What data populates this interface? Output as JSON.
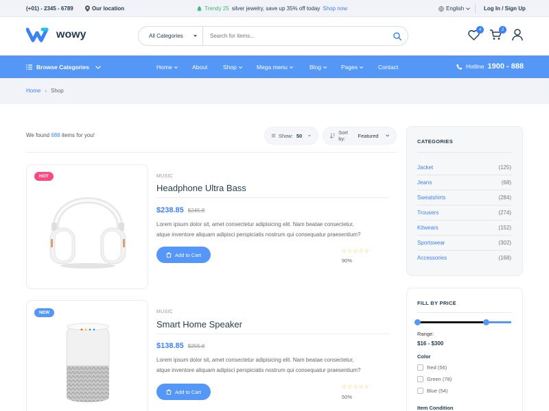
{
  "topbar": {
    "phone": "(+01) - 2345 - 6789",
    "location": "Our location",
    "promo_highlight": "Trendy 25",
    "promo_text": "silver jewelry, save up 35% off today",
    "promo_link": "Shop now",
    "language": "English",
    "login": "Log In / Sign Up"
  },
  "header": {
    "logo": "wowy",
    "search_category": "All Categories",
    "search_placeholder": "Search for items...",
    "wishlist_count": "4",
    "cart_count": "2"
  },
  "nav": {
    "browse": "Browse Categories",
    "items": [
      "Home",
      "About",
      "Shop",
      "Mega menu",
      "Blog",
      "Pages",
      "Contact"
    ],
    "hotline_label": "Hotline",
    "hotline_number": "1900 - 888"
  },
  "breadcrumb": {
    "home": "Home",
    "current": "Shop"
  },
  "toolbar": {
    "found_prefix": "We found",
    "found_count": "688",
    "found_suffix": "items for you!",
    "show_label": "Show:",
    "show_value": "50",
    "sort_label": "Sort by:",
    "sort_value": "Featured"
  },
  "products": [
    {
      "tag": "HOT",
      "category": "MUSIC",
      "title": "Headphone Ultra Bass",
      "price": "$238.85",
      "old_price": "$245.8",
      "desc_1": "Lorem ipsum dolor sit, amet consectetur adipisicing elit. Nam beatae consectetur,",
      "desc_2": "atque inventore aliquam adipisci perspiciatis nostrum qui consequatur praesentium?",
      "cart_label": "Add to Cart",
      "stars": "☆☆☆☆☆",
      "rating": "90%"
    },
    {
      "tag": "NEW",
      "category": "MUSIC",
      "title": "Smart Home Speaker",
      "price": "$138.85",
      "old_price": "$255.8",
      "desc_1": "Lorem ipsum dolor sit, amet consectetur adipisicing elit. Nam beatae consectetur,",
      "desc_2": "atque inventore aliquam adipisci perspiciatis nostrum qui consequatur praesentium?",
      "cart_label": "Add to Cart",
      "stars": "☆☆☆☆☆",
      "rating": "50%"
    }
  ],
  "sidebar": {
    "categories_title": "CATEGORIES",
    "categories": [
      {
        "name": "Jacket",
        "count": "(125)"
      },
      {
        "name": "Jeans",
        "count": "(68)"
      },
      {
        "name": "Sweatshirts",
        "count": "(284)"
      },
      {
        "name": "Trousers",
        "count": "(274)"
      },
      {
        "name": "Kitwears",
        "count": "(152)"
      },
      {
        "name": "Sportswear",
        "count": "(302)"
      },
      {
        "name": "Accessories",
        "count": "(168)"
      }
    ],
    "price_title": "FILL BY PRICE",
    "range_label": "Range:",
    "range_value": "$16 - $300",
    "color_title": "Color",
    "colors": [
      "Red (56)",
      "Green (78)",
      "Blue (54)"
    ],
    "condition_title": "Item Condition"
  },
  "colors": {
    "accent": "#5497f7",
    "link": "#3b82f6",
    "hot": "#f74b81",
    "star": "#fdc040",
    "dark": "#253d4e"
  }
}
